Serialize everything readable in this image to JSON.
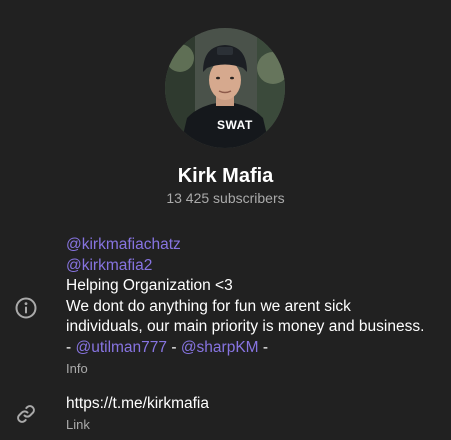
{
  "channel": {
    "name": "Kirk Mafia",
    "subscribers": "13 425 subscribers",
    "avatar_badge": "SWAT"
  },
  "info": {
    "mention1": "@kirkmafiachatz",
    "mention2": "@kirkmafia2",
    "line3": "Helping Organization <3",
    "line4": "We dont do anything for fun we arent sick",
    "line5": "individuals, our main priority is money and business.",
    "line6_prefix": "- ",
    "line6_mention1": "@utilman777",
    "line6_sep": " - ",
    "line6_mention2": "@sharpKM",
    "line6_suffix": " -",
    "caption": "Info",
    "icon": "info-circle-icon"
  },
  "link": {
    "url": "https://t.me/kirkmafia",
    "caption": "Link",
    "icon": "link-icon"
  },
  "colors": {
    "background": "#212121",
    "accent": "#8774e1",
    "secondary_text": "#aaaaaa"
  }
}
